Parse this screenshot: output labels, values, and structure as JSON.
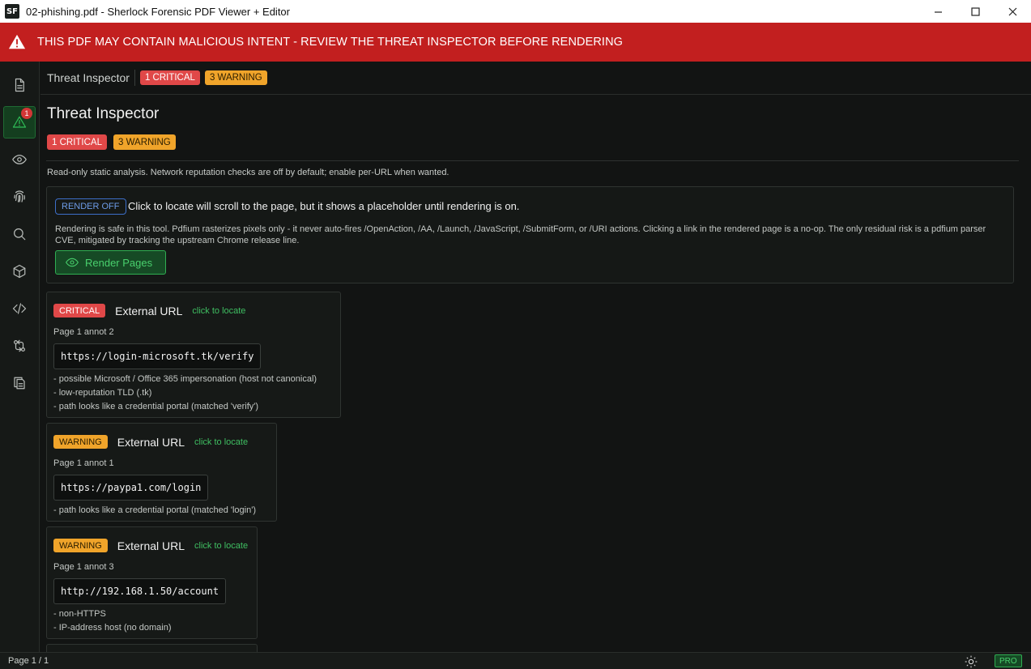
{
  "window": {
    "app_logo": "SF",
    "title": "02-phishing.pdf - Sherlock Forensic PDF Viewer + Editor"
  },
  "banner": {
    "text": "THIS PDF MAY CONTAIN MALICIOUS INTENT - REVIEW THE THREAT INSPECTOR BEFORE RENDERING",
    "color": "#c21f1f"
  },
  "sidebar": {
    "items": [
      {
        "icon": "document-icon"
      },
      {
        "icon": "warning-icon",
        "active": true,
        "badge": "1"
      },
      {
        "icon": "eye-icon"
      },
      {
        "icon": "fingerprint-icon"
      },
      {
        "icon": "search-icon"
      },
      {
        "icon": "cube-icon"
      },
      {
        "icon": "code-icon"
      },
      {
        "icon": "git-compare-icon"
      },
      {
        "icon": "copy-document-icon"
      }
    ]
  },
  "toolbar": {
    "title": "Threat Inspector",
    "critical_badge": "1 CRITICAL",
    "warning_badge": "3 WARNING"
  },
  "inspector": {
    "title": "Threat Inspector",
    "critical_badge": "1 CRITICAL",
    "warning_badge": "3 WARNING",
    "readonly_note": "Read-only static analysis. Network reputation checks are off by default; enable per-URL when wanted.",
    "render_status": "RENDER OFF",
    "locate_note": "Click to locate will scroll to the page, but it shows a placeholder until rendering is on.",
    "safe_note": "Rendering is safe in this tool. Pdfium rasterizes pixels only - it never auto-fires /OpenAction, /AA, /Launch, /JavaScript, /SubmitForm, or /URI actions. Clicking a link in the rendered page is a no-op. The only residual risk is a pdfium parser CVE, mitigated by tracking the upstream Chrome release line.",
    "render_button": "Render Pages"
  },
  "findings": [
    {
      "severity": "CRITICAL",
      "type": "External URL",
      "locate": "click to locate",
      "location": "Page 1 annot 2",
      "url": "https://login-microsoft.tk/verify",
      "reasons": [
        "- possible Microsoft / Office 365 impersonation (host not canonical)",
        "- low-reputation TLD (.tk)",
        "- path looks like a credential portal (matched 'verify')"
      ]
    },
    {
      "severity": "WARNING",
      "type": "External URL",
      "locate": "click to locate",
      "location": "Page 1 annot 1",
      "url": "https://paypa1.com/login",
      "reasons": [
        "- path looks like a credential portal (matched 'login')"
      ]
    },
    {
      "severity": "WARNING",
      "type": "External URL",
      "locate": "click to locate",
      "location": "Page 1 annot 3",
      "url": "http://192.168.1.50/account",
      "reasons": [
        "- non-HTTPS",
        "- IP-address host (no domain)"
      ]
    }
  ],
  "statusbar": {
    "page": "Page 1 / 1",
    "theme_icon": "sun-icon",
    "plan": "PRO"
  },
  "colors": {
    "critical": "#e04848",
    "warning": "#f0a42a",
    "accent_green": "#2fbf57",
    "render_off_blue": "#3d6fc9"
  }
}
